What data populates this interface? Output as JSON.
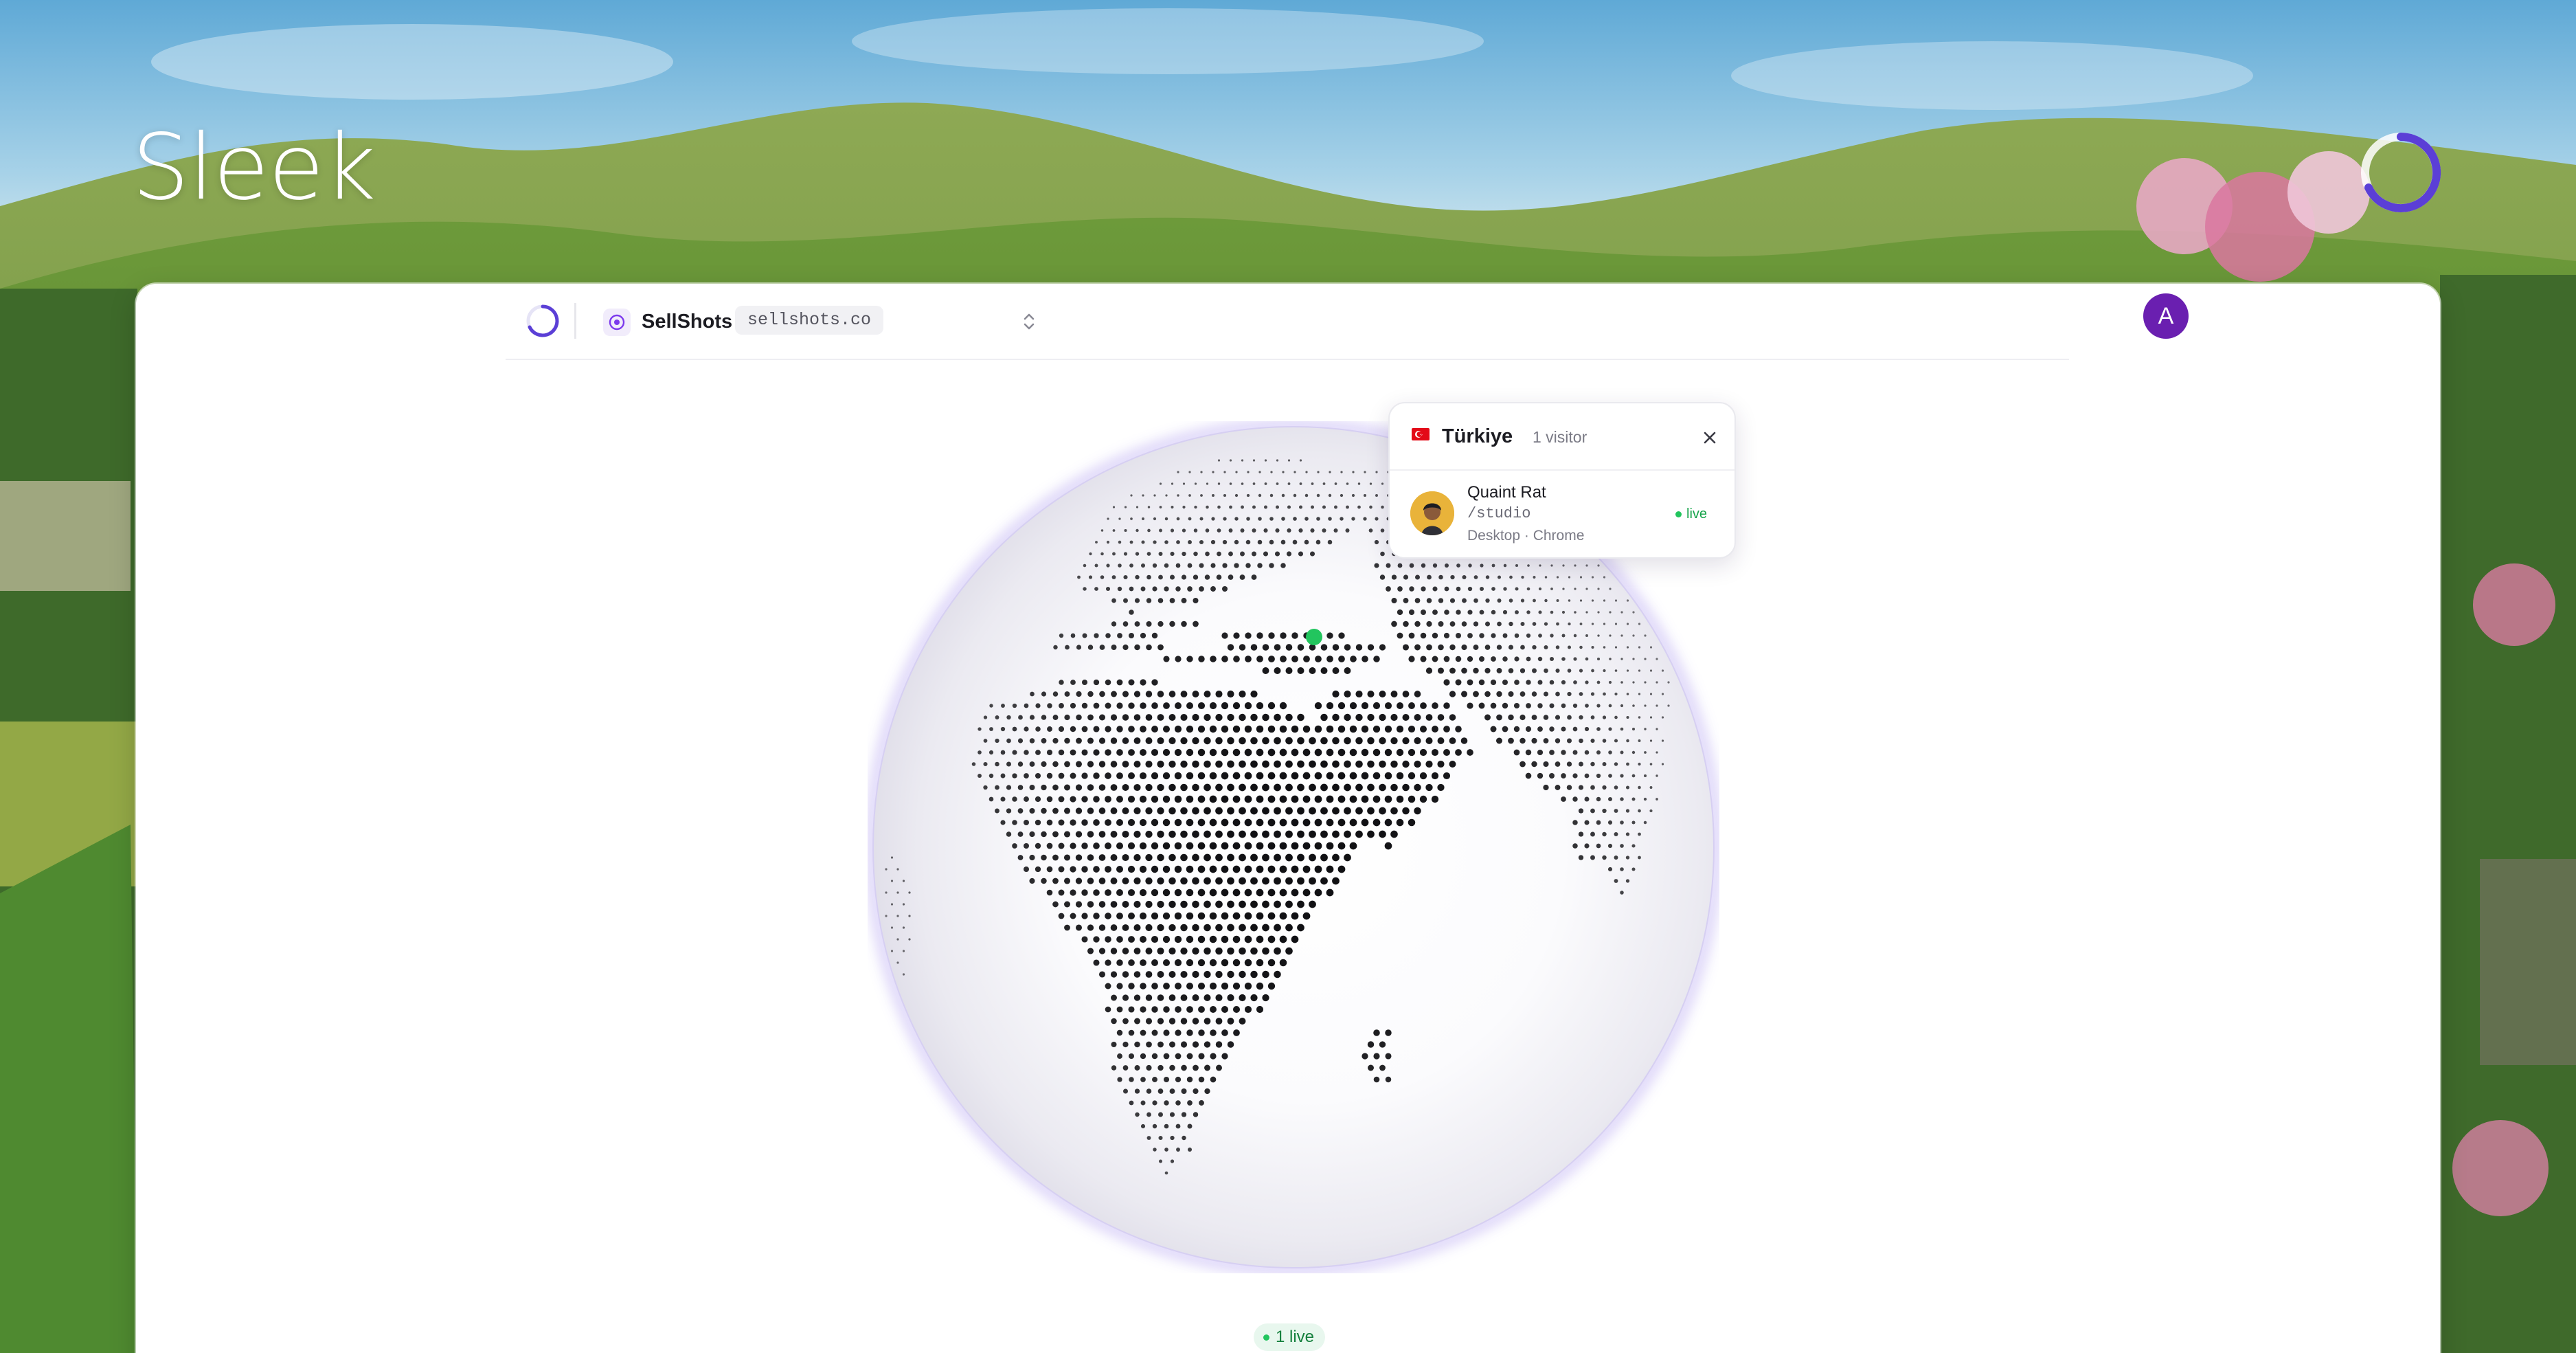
{
  "brand": {
    "name": "Sleek"
  },
  "topbar": {
    "site_name": "SellShots",
    "domain": "sellshots.co",
    "user_initial": "A"
  },
  "popup": {
    "country": "Türkiye",
    "visitor_count": "1 visitor",
    "visitor": {
      "name": "Quaint Rat",
      "path": "/studio",
      "device": "Desktop · Chrome",
      "status": "live"
    }
  },
  "live_indicator": "1 live",
  "colors": {
    "accent": "#6a1fb0",
    "spinner": "#5b3fd6",
    "live": "#22c55e",
    "flag": "#e30a17"
  },
  "icons": {
    "site": "sellshots-logo-icon",
    "switcher": "chevron-up-down-icon",
    "close": "close-icon",
    "spinner": "loading-spinner-icon"
  }
}
